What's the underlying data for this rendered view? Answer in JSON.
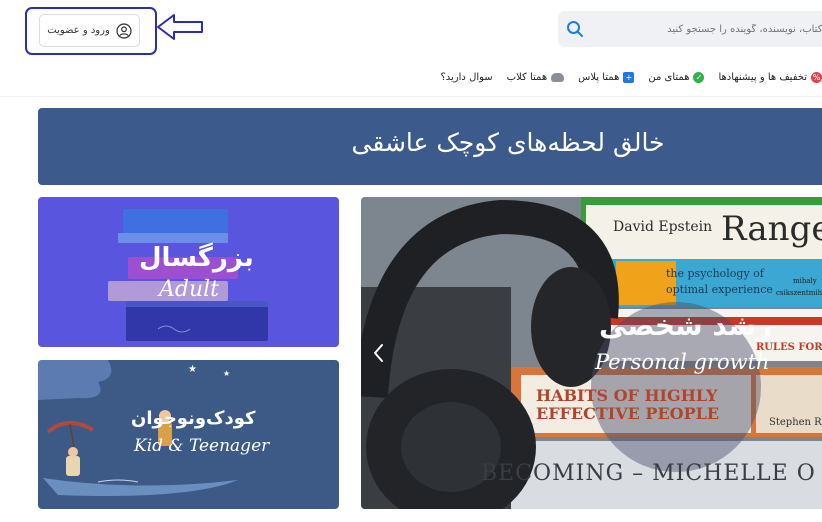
{
  "header": {
    "login_label": "ورود و عضویت",
    "search_placeholder": "...کتاب، نویسنده، گوینده را جستجو کنید"
  },
  "nav": [
    {
      "label": "تخفیف ها و پیشنهادها",
      "icon": "discount-icon",
      "color": "#e0414c"
    },
    {
      "label": "همتای من",
      "icon": "shield-check-icon",
      "color": "#2eb34a"
    },
    {
      "label": "همتا پلاس",
      "icon": "plus-icon",
      "color": "#1f7ae0"
    },
    {
      "label": "همتا کلاب",
      "icon": "club-icon",
      "color": "#8a8f96"
    },
    {
      "label": "سوال دارید؟",
      "icon": "",
      "color": ""
    }
  ],
  "banner": {
    "text": "خالق لحظه‌های کوچک عاشقی"
  },
  "cards": {
    "adult": {
      "fa": "بزرگسال",
      "en": "Adult"
    },
    "kid": {
      "fa": "کودک‌ونوجوان",
      "en": "Kid & Teenager"
    },
    "growth": {
      "fa": "رشد شخصی",
      "en": "Personal growth"
    }
  },
  "books": {
    "range_author": "David Epstein",
    "range_title": "Range",
    "psych_line1": "the psychology of",
    "psych_line2": "optimal experience",
    "rules_line": "RULES FOR LIF",
    "habits_line1": "HABITS OF HIGHLY",
    "habits_line2": "EFFECTIVE PEOPLE",
    "stephen": "Stephen R",
    "becoming": "BECOMING – MICHELLE O",
    "mihaly": "mihaly",
    "csik": "csikszentmih"
  },
  "colors": {
    "accent": "#1f7ae0",
    "banner": "#3c5b8c",
    "adult": "#5a55df",
    "kid": "#3d5a86",
    "highlight": "#2a2fb0"
  }
}
